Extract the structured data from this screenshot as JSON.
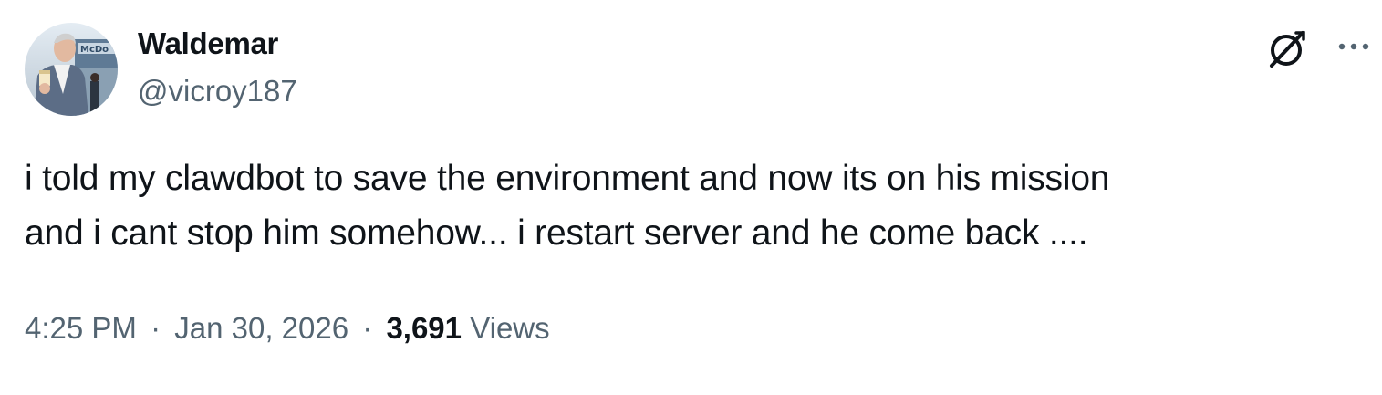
{
  "author": {
    "display_name": "Waldemar",
    "handle": "@vicroy187",
    "avatar_icon": "profile-photo"
  },
  "tweet": {
    "text_lines": [
      "i told my clawdbot to save the environment and now its on his mission",
      "and i cant stop him somehow... i restart server and he come back ...."
    ]
  },
  "meta": {
    "time": "4:25 PM",
    "date": "Jan 30, 2026",
    "separator": "·",
    "views_count": "3,691",
    "views_label": "Views"
  },
  "actions": {
    "grok_icon": "grok-icon",
    "more_icon": "more-options-icon"
  },
  "colors": {
    "text_primary": "#0f1419",
    "text_secondary": "#536471",
    "background": "#ffffff"
  }
}
